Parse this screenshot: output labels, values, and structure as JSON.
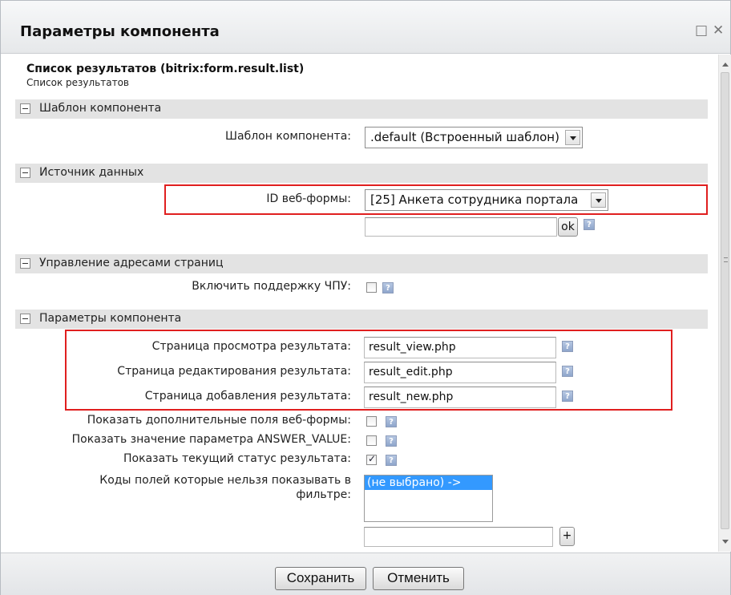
{
  "window": {
    "title": "Параметры компонента"
  },
  "component": {
    "title": "Список результатов (bitrix:form.result.list)",
    "subtitle": "Список результатов"
  },
  "sections": [
    {
      "label": "Шаблон компонента"
    },
    {
      "label": "Источник данных"
    },
    {
      "label": "Управление адресами страниц"
    },
    {
      "label": "Параметры компонента"
    }
  ],
  "template_section": {
    "label": "Шаблон компонента:",
    "select_value": ".default (Встроенный шаблон)"
  },
  "data_source": {
    "label": "ID веб-формы:",
    "select_value": "[25] Анкета сотрудника портала",
    "extra_value": "",
    "ok_label": "ok"
  },
  "url_section": {
    "sef_label": "Включить поддержку ЧПУ:",
    "sef_checked": false
  },
  "params": {
    "view_label": "Страница просмотра результата:",
    "view_value": "result_view.php",
    "edit_label": "Страница редактирования результата:",
    "edit_value": "result_edit.php",
    "new_label": "Страница добавления результата:",
    "new_value": "result_new.php",
    "show_additional_label": "Показать дополнительные поля веб-формы:",
    "show_additional_checked": false,
    "show_answer_label": "Показать значение параметра ANSWER_VALUE:",
    "show_answer_checked": false,
    "show_status_label": "Показать текущий статус результата:",
    "show_status_checked": true,
    "filter_codes_label_1": "Коды полей которые нельзя показывать в",
    "filter_codes_label_2": "фильтре:",
    "filter_codes_option": "(не выбрано) ->",
    "filter_codes_add_value": "",
    "add_button": "+"
  },
  "help_icon": "?",
  "footer": {
    "save_label": "Сохранить",
    "cancel_label": "Отменить"
  },
  "colors": {
    "highlight": "#e01f1f",
    "selected_option": "#3399ff"
  },
  "icons": [
    "maximize-icon",
    "close-icon",
    "collapse-icon",
    "help-icon",
    "dropdown-arrow-icon",
    "checkbox-icon"
  ]
}
